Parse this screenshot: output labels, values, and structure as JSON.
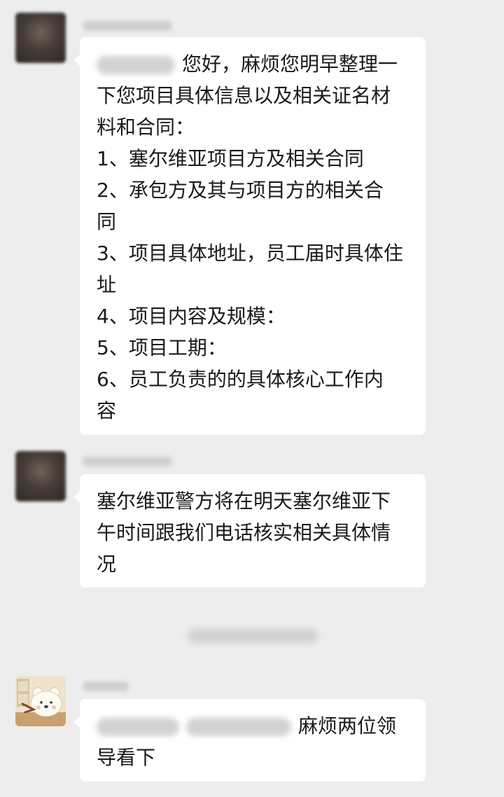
{
  "messages": [
    {
      "sender": "blurred",
      "avatar": "person-avatar",
      "mention_blurred": true,
      "lines": [
        "您好，麻烦您明早整理一",
        "下您项目具体信息以及相关证名材",
        "料和合同：",
        "1、塞尔维亚项目方及相关合同",
        "2、承包方及其与项目方的相关合",
        "同",
        "3、项目具体地址，员工届时具体住",
        "址",
        "4、项目内容及规模：",
        "5、项目工期：",
        "6、员工负责的的具体核心工作内",
        "容"
      ]
    },
    {
      "sender": "blurred",
      "avatar": "person-avatar",
      "lines": [
        "塞尔维亚警方将在明天塞尔维亚下",
        "午时间跟我们电话核实相关具体情",
        "况"
      ]
    },
    {
      "sender": "blurred",
      "avatar": "bear-sticker-avatar",
      "mentions_blurred": 2,
      "lines": [
        "麻烦两位领",
        "导看下"
      ]
    }
  ],
  "colors": {
    "background": "#ededed",
    "bubble": "#ffffff",
    "text": "#1a1a1a"
  }
}
